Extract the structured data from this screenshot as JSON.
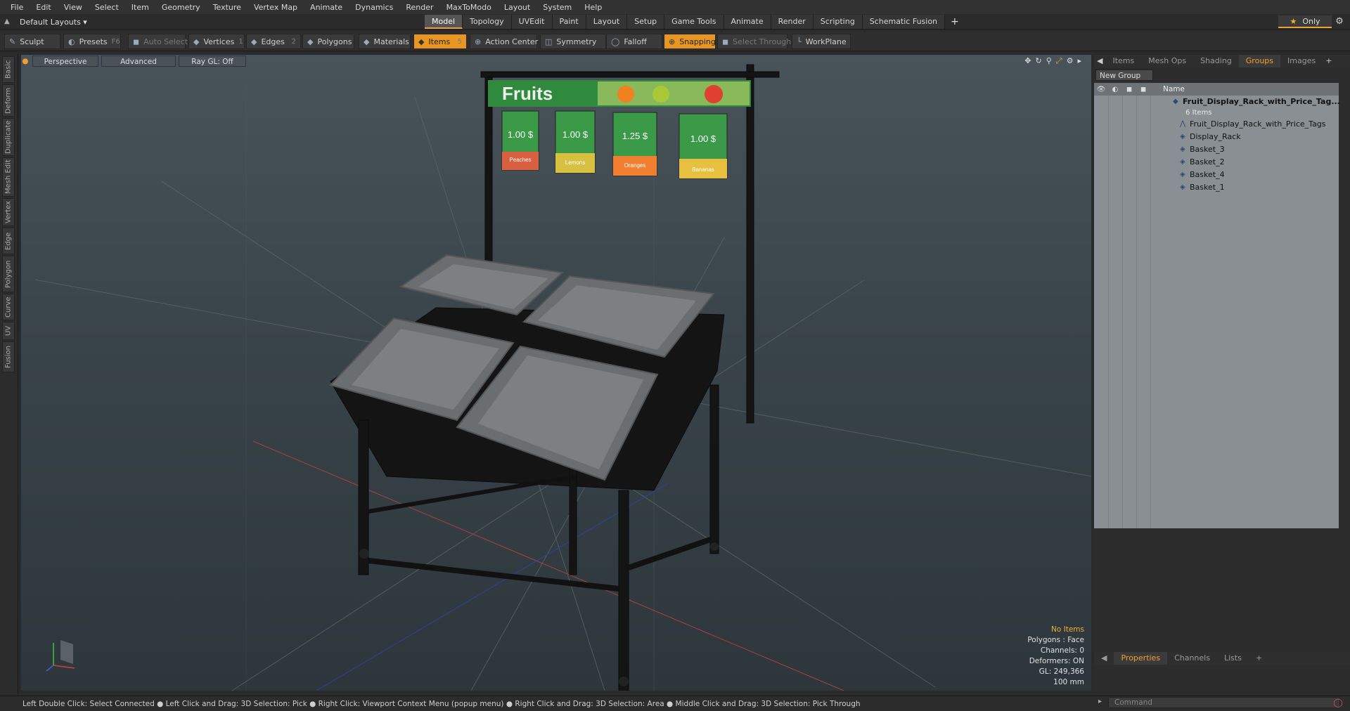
{
  "menu": [
    "File",
    "Edit",
    "View",
    "Select",
    "Item",
    "Geometry",
    "Texture",
    "Vertex Map",
    "Animate",
    "Dynamics",
    "Render",
    "MaxToModo",
    "Layout",
    "System",
    "Help"
  ],
  "layout_selector": "Default Layouts ▾",
  "mode_tabs": [
    "Model",
    "Topology",
    "UVEdit",
    "Paint",
    "Layout",
    "Setup",
    "Game Tools",
    "Animate",
    "Render",
    "Scripting",
    "Schematic Fusion"
  ],
  "active_mode": "Model",
  "add_tab": "+",
  "only_label": "Only",
  "toolbar": {
    "sculpt": "Sculpt",
    "presets": "Presets",
    "presets_key": "F6",
    "auto_select": "Auto Select",
    "vertices": "Vertices",
    "vertices_key": "1",
    "edges": "Edges",
    "edges_key": "2",
    "polygons": "Polygons",
    "materials": "Materials",
    "items": "Items",
    "items_key": "5",
    "action_center": "Action Center",
    "symmetry": "Symmetry",
    "falloff": "Falloff",
    "snapping": "Snapping",
    "select_through": "Select Through",
    "workplane": "WorkPlane"
  },
  "left_tabs": [
    "Basic",
    "Deform",
    "Duplicate",
    "Mesh Edit",
    "Vertex",
    "Edge",
    "Polygon",
    "Curve",
    "UV",
    "Fusion"
  ],
  "viewport": {
    "view": "Perspective",
    "shading": "Advanced",
    "raygl": "Ray GL: Off",
    "banner": "Fruits",
    "tags": [
      "1.00 $",
      "1.00 $",
      "1.25 $",
      "1.00 $"
    ],
    "tag_names": [
      "Peaches",
      "Lemons",
      "Oranges",
      "Bananas"
    ],
    "stats": {
      "selection": "No Items",
      "polygons": "Polygons : Face",
      "channels": "Channels: 0",
      "deformers": "Deformers: ON",
      "gl": "GL: 249,366",
      "scale": "100 mm"
    }
  },
  "right_panel": {
    "tabs": [
      "Items",
      "Mesh Ops",
      "Shading",
      "Groups",
      "Images"
    ],
    "active_tab": "Groups",
    "new_group": "New Group",
    "name_col": "Name",
    "root": "Fruit_Display_Rack_with_Price_Tag...",
    "root_count": "6 Items",
    "children": [
      "Fruit_Display_Rack_with_Price_Tags",
      "Display_Rack",
      "Basket_3",
      "Basket_2",
      "Basket_4",
      "Basket_1"
    ],
    "bottom_tabs": [
      "Properties",
      "Channels",
      "Lists"
    ],
    "active_bottom": "Properties",
    "command_placeholder": "Command"
  },
  "status": "Left Double Click: Select Connected ● Left Click and Drag: 3D Selection: Pick ● Right Click: Viewport Context Menu (popup menu) ● Right Click and Drag: 3D Selection: Area ● Middle Click and Drag: 3D Selection: Pick Through",
  "colors": {
    "accent": "#f0a030",
    "panel": "#8a8f93",
    "viewport_top": "#48535a",
    "viewport_bottom": "#2c363b"
  }
}
